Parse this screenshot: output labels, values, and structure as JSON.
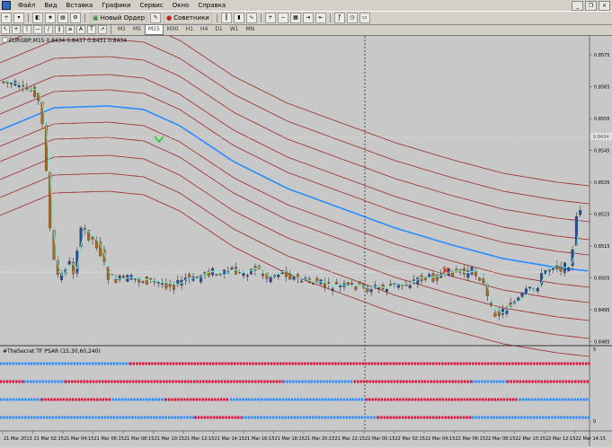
{
  "menu": {
    "items": [
      "Файл",
      "Вид",
      "Вставка",
      "Графики",
      "Сервис",
      "Окно",
      "Справка"
    ]
  },
  "toolbar": {
    "new_order_label": "Новый Ордер",
    "advisors_label": "Советники"
  },
  "timeframes": [
    "M1",
    "M5",
    "M15",
    "M30",
    "H1",
    "H4",
    "D1",
    "W1",
    "MN"
  ],
  "active_timeframe": "M15",
  "chart": {
    "header": "EURGBP,M15  0.8434 0.8437 0.8431 0.8434",
    "bid_tag": "0.8434",
    "price_labels": [
      "0.8575",
      "0.8565",
      "0.8555",
      "0.8545",
      "0.8535",
      "0.8525",
      "0.8515",
      "0.8505",
      "0.8495",
      "0.8485"
    ],
    "time_labels": [
      "21 Mar 2013",
      "21 Mar 02:15",
      "21 Mar 04:15",
      "21 Mar 06:15",
      "21 Mar 08:15",
      "21 Mar 10:15",
      "21 Mar 12:15",
      "21 Mar 14:15",
      "21 Mar 16:15",
      "21 Mar 18:15",
      "21 Mar 20:15",
      "21 Mar 22:15",
      "22 Mar 00:15",
      "22 Mar 02:15",
      "22 Mar 04:15",
      "22 Mar 06:15",
      "22 Mar 08:15",
      "22 Mar 10:15",
      "22 Mar 12:15",
      "22 Mar 14:15"
    ]
  },
  "indicator": {
    "title": "#TheSecret TF PSAR (15,30,60,240)",
    "scale_top": "5",
    "scale_bottom": "0",
    "colors": {
      "up": "#2a8cff",
      "down": "#e0103a"
    },
    "rows": [
      [
        [
          0,
          0.22,
          "up"
        ],
        [
          0.22,
          1.0,
          "down"
        ]
      ],
      [
        [
          0,
          0.04,
          "down"
        ],
        [
          0.04,
          0.11,
          "up"
        ],
        [
          0.11,
          0.48,
          "down"
        ],
        [
          0.48,
          0.6,
          "up"
        ],
        [
          0.6,
          0.8,
          "down"
        ],
        [
          0.8,
          0.86,
          "up"
        ],
        [
          0.86,
          1.0,
          "down"
        ]
      ],
      [
        [
          0,
          0.07,
          "up"
        ],
        [
          0.07,
          0.19,
          "down"
        ],
        [
          0.19,
          0.28,
          "up"
        ],
        [
          0.28,
          0.39,
          "down"
        ],
        [
          0.39,
          0.62,
          "up"
        ],
        [
          0.62,
          0.88,
          "down"
        ],
        [
          0.88,
          1.0,
          "up"
        ]
      ],
      [
        [
          0,
          0.33,
          "up"
        ],
        [
          0.33,
          0.41,
          "down"
        ],
        [
          0.41,
          0.64,
          "up"
        ],
        [
          0.64,
          0.8,
          "down"
        ],
        [
          0.8,
          1.0,
          "up"
        ]
      ]
    ]
  },
  "colors": {
    "chart_bg": "#c8c8c8",
    "grid": "#b4b4b4",
    "envelope": "#9c2a2a",
    "ma": "#2a8cff",
    "candle_up": "#2c4a9c",
    "candle_down": "#b06a1a",
    "signal_line": "#80e6d0",
    "x_marker": "#e8402a",
    "arrow_marker": "#22cc22"
  }
}
